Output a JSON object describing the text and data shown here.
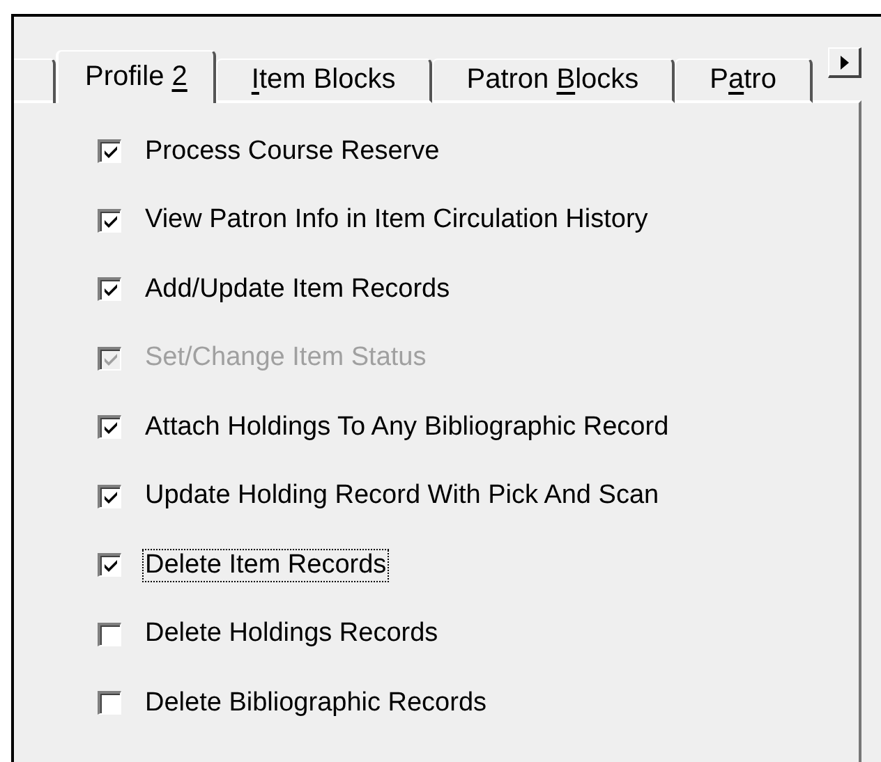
{
  "tabs": [
    {
      "label_before": "Profile ",
      "access_key": "2",
      "selected": true
    },
    {
      "access_key": "I",
      "label_after": "tem Blocks",
      "selected": false
    },
    {
      "label_before": "Patron ",
      "access_key": "B",
      "label_after": "locks",
      "selected": false
    },
    {
      "label_before": "P",
      "access_key": "a",
      "label_after": "tro",
      "selected": false
    }
  ],
  "options": [
    {
      "label": "Process Course Reserve",
      "checked": true,
      "disabled": false,
      "focused": false
    },
    {
      "label": "View Patron Info in Item Circulation History",
      "checked": true,
      "disabled": false,
      "focused": false
    },
    {
      "label": "Add/Update Item Records",
      "checked": true,
      "disabled": false,
      "focused": false
    },
    {
      "label": "Set/Change Item Status",
      "checked": true,
      "disabled": true,
      "focused": false
    },
    {
      "label": "Attach Holdings To Any Bibliographic Record",
      "checked": true,
      "disabled": false,
      "focused": false
    },
    {
      "label": "Update Holding Record With Pick And Scan",
      "checked": true,
      "disabled": false,
      "focused": false
    },
    {
      "label": "Delete Item Records",
      "checked": true,
      "disabled": false,
      "focused": true
    },
    {
      "label": "Delete Holdings Records",
      "checked": false,
      "disabled": false,
      "focused": false
    },
    {
      "label": "Delete Bibliographic Records",
      "checked": false,
      "disabled": false,
      "focused": false
    }
  ]
}
